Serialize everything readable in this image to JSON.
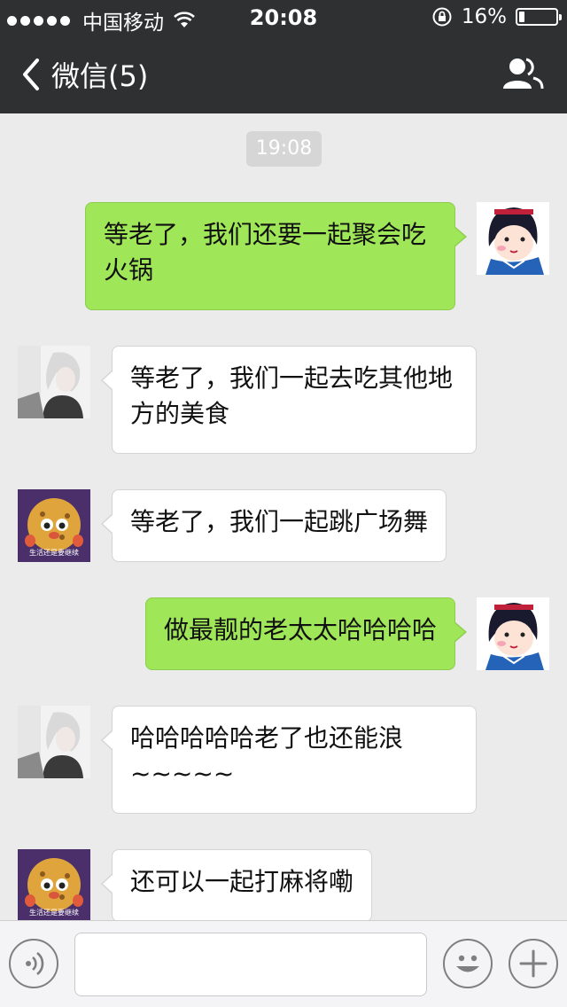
{
  "status_bar": {
    "carrier": "中国移动",
    "time": "20:08",
    "battery": "16%",
    "battery_level": 0.16
  },
  "nav": {
    "title": "微信(5)"
  },
  "chat": {
    "timestamp": "19:08",
    "messages": [
      {
        "side": "out",
        "avatar": "snow-white-avatar",
        "text": "等老了，我们还要一起聚会吃火锅"
      },
      {
        "side": "in",
        "avatar": "white-hair-boy-avatar",
        "text": "等老了，我们一起去吃其他地方的美食"
      },
      {
        "side": "in",
        "avatar": "cookie-character-avatar",
        "text": "等老了，我们一起跳广场舞",
        "avatar_caption": "生活还是要继续"
      },
      {
        "side": "out",
        "avatar": "snow-white-avatar",
        "text": "做最靓的老太太哈哈哈哈"
      },
      {
        "side": "in",
        "avatar": "white-hair-boy-avatar",
        "text": "哈哈哈哈哈老了也还能浪~~~~~"
      },
      {
        "side": "in",
        "avatar": "cookie-character-avatar",
        "text": "还可以一起打麻将嘞",
        "avatar_caption": "生活还是要继续"
      }
    ]
  },
  "input_bar": {
    "placeholder": ""
  },
  "colors": {
    "bar_bg": "#2e3032",
    "chat_bg": "#ebebeb",
    "out_bubble": "#9fe658",
    "in_bubble": "#ffffff"
  }
}
